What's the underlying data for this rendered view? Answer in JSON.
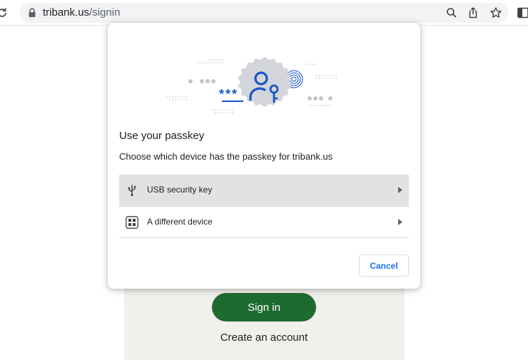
{
  "browser": {
    "url_domain": "tribank.us",
    "url_path": "/signin",
    "icons": [
      "reload-icon",
      "lock-icon",
      "zoom-icon",
      "share-icon",
      "bookmark-star-icon",
      "side-panel-icon"
    ]
  },
  "dialog": {
    "title": "Use your passkey",
    "subtitle": "Choose which device has the passkey for tribank.us",
    "illustration_password_mask": "***",
    "options": [
      {
        "label": "USB security key",
        "icon": "usb-icon",
        "selected": true
      },
      {
        "label": "A different device",
        "icon": "qr-code-icon",
        "selected": false
      }
    ],
    "cancel_label": "Cancel"
  },
  "page": {
    "signin_label": "Sign in",
    "create_account_label": "Create an account"
  },
  "colors": {
    "accent_blue": "#1a73e8",
    "illustration_blue": "#1a56c8",
    "signin_green": "#1e6b30",
    "selected_row": "#e2e2e5",
    "card_bg": "#f1f0ec"
  }
}
